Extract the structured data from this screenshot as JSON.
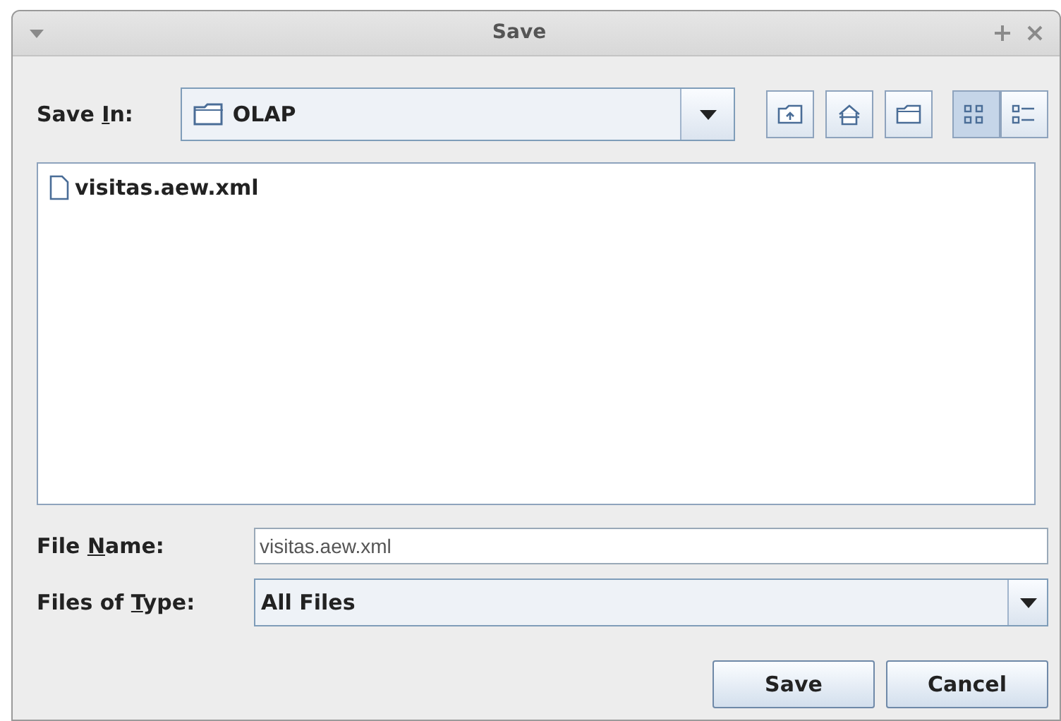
{
  "window": {
    "title": "Save"
  },
  "save_in": {
    "label": {
      "before": "Save ",
      "key": "I",
      "after": "n:"
    },
    "value": "OLAP"
  },
  "toolbar": [
    {
      "kind": "up",
      "selected": false
    },
    {
      "kind": "home",
      "selected": false
    },
    {
      "kind": "new-folder",
      "selected": false
    },
    {
      "kind": "list",
      "selected": true
    },
    {
      "kind": "details",
      "selected": false
    }
  ],
  "files": [
    {
      "name": "visitas.aew.xml",
      "selected": false
    }
  ],
  "file_name": {
    "label": {
      "before": "File ",
      "key": "N",
      "after": "ame:"
    },
    "value": "visitas.aew.xml"
  },
  "file_type": {
    "label": {
      "before": "Files of ",
      "key": "T",
      "after": "ype:"
    },
    "value": "All Files"
  },
  "buttons": [
    "Save",
    "Cancel"
  ]
}
